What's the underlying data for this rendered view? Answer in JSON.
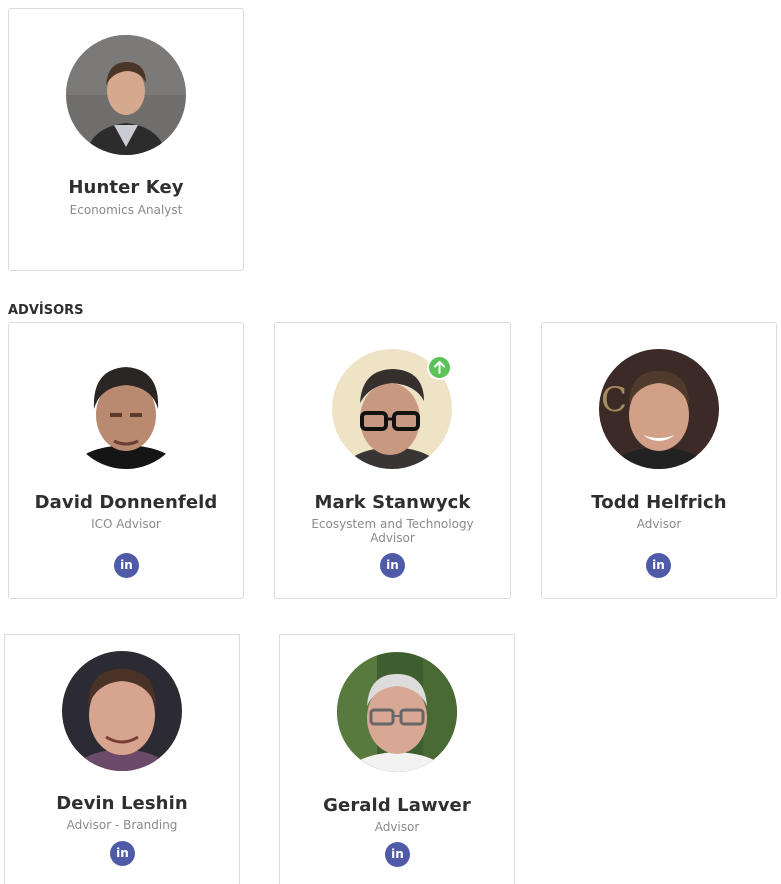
{
  "team_member": {
    "name": "Hunter Key",
    "role": "Economics Analyst",
    "avatar_icon": "person-photo"
  },
  "advisors_section": {
    "title": "ADVİSORS"
  },
  "advisors": [
    {
      "name": "David Donnenfeld",
      "role": "ICO Advisor",
      "social": "in",
      "social_icon": "linkedin-icon"
    },
    {
      "name": "Mark Stanwyck",
      "role": "Ecosystem and Technology Advisor",
      "social": "in",
      "social_icon": "linkedin-icon",
      "badge_icon": "arrow-up-icon"
    },
    {
      "name": "Todd Helfrich",
      "role": "Advisor",
      "social": "in",
      "social_icon": "linkedin-icon"
    },
    {
      "name": "Devin Leshin",
      "role": "Advisor - Branding",
      "social": "in",
      "social_icon": "linkedin-icon"
    },
    {
      "name": "Gerald Lawver",
      "role": "Advisor",
      "social": "in",
      "social_icon": "linkedin-icon"
    }
  ],
  "colors": {
    "linkedin": "#4f5ba8",
    "badge_green": "#5cc25a",
    "text_dark": "#2f2f2f",
    "text_muted": "#8a8a8a",
    "card_border": "#dcdcdc"
  }
}
